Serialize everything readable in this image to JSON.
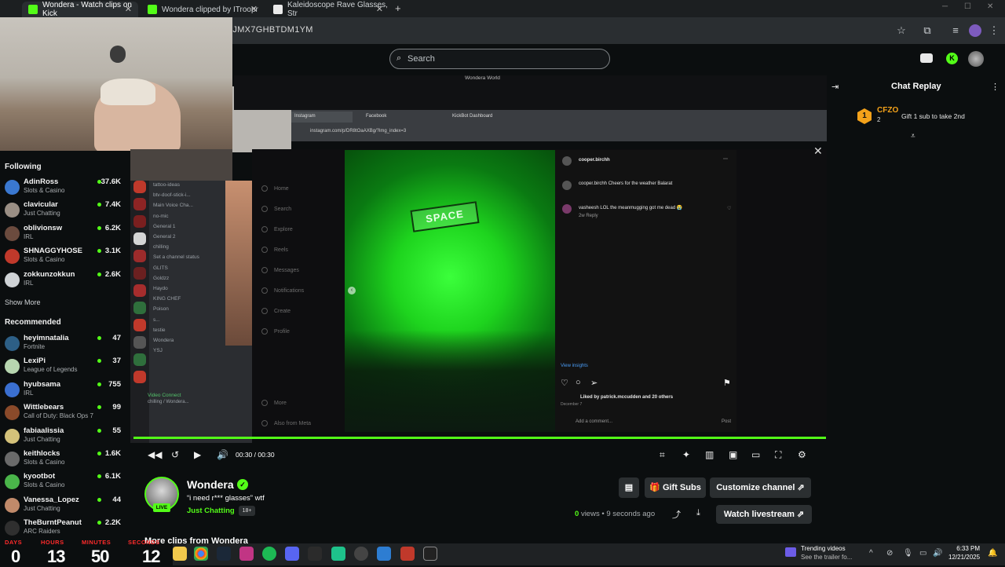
{
  "browser": {
    "tabs": [
      {
        "label": "Wondera - Watch clips on Kick",
        "active": true
      },
      {
        "label": "Wondera clipped by ITroopr",
        "active": false
      },
      {
        "label": "Kaleidoscope Rave Glasses, Str",
        "active": false
      }
    ],
    "url_fragment": "0JMX7GHBTDM1YM"
  },
  "kick": {
    "search_placeholder": "Search",
    "chat_title": "Chat Replay",
    "pinned": {
      "name": "CFZO",
      "count": "2",
      "message": "Gift 1 sub to take 2nd",
      "badge": "1"
    }
  },
  "sidebar": {
    "following_title": "Following",
    "following": [
      {
        "name": "AdinRoss",
        "category": "Slots & Casino",
        "viewers": "37.6K",
        "color": "#3a78d0"
      },
      {
        "name": "clavicular",
        "category": "Just Chatting",
        "viewers": "7.4K",
        "color": "#9a8f85"
      },
      {
        "name": "oblivionsw",
        "category": "IRL",
        "viewers": "6.2K",
        "color": "#6b4b3e"
      },
      {
        "name": "SHNAGGYHOSE",
        "category": "Slots & Casino",
        "viewers": "3.1K",
        "color": "#c0392b"
      },
      {
        "name": "zokkunzokkun",
        "category": "IRL",
        "viewers": "2.6K",
        "color": "#cfd3d6"
      }
    ],
    "show_more": "Show More",
    "recommended_title": "Recommended",
    "recommended": [
      {
        "name": "heyimnatalia",
        "category": "Fortnite",
        "viewers": "47",
        "color": "#2d5f86"
      },
      {
        "name": "LexiPi",
        "category": "League of Legends",
        "viewers": "37",
        "color": "#b7d6b0"
      },
      {
        "name": "hyubsama",
        "category": "IRL",
        "viewers": "755",
        "color": "#3a6fd0"
      },
      {
        "name": "Wittlebears",
        "category": "Call of Duty: Black Ops 7",
        "viewers": "99",
        "color": "#8a4a2a"
      },
      {
        "name": "fabiaalissia",
        "category": "Just Chatting",
        "viewers": "55",
        "color": "#d4c27a"
      },
      {
        "name": "keithlocks",
        "category": "Slots & Casino",
        "viewers": "1.6K",
        "color": "#6a6a6a"
      },
      {
        "name": "kyootbot",
        "category": "Slots & Casino",
        "viewers": "6.1K",
        "color": "#4ab54a"
      },
      {
        "name": "Vanessa_Lopez",
        "category": "Just Chatting",
        "viewers": "44",
        "color": "#c08a6a"
      },
      {
        "name": "TheBurntPeanut",
        "category": "ARC Raiders",
        "viewers": "2.2K",
        "color": "#2f2f2f"
      }
    ]
  },
  "video": {
    "time": "00:30 / 00:30",
    "instagram": {
      "tabs": [
        "Instagram",
        "Facebook",
        "KickBot Dashboard"
      ],
      "url": "instagram.com/p/DR8tOaAXBg/?img_index=3",
      "user": "cooper.birchh",
      "caption": "cooper.birchh Cheers for the weather Balarat",
      "comment_user": "vasheesh",
      "comment": "vasheesh LOL the meanmugging got me dead 😭",
      "reply": "2w  Reply",
      "view_insights": "View insights",
      "liked_by": "Liked by patrick.mccudden and 20 others",
      "date": "December 7",
      "add_comment": "Add a comment...",
      "post": "Post",
      "menu": [
        "Home",
        "Search",
        "Explore",
        "Reels",
        "Messages",
        "Notifications",
        "Create",
        "Profile",
        "More",
        "Also from Meta"
      ],
      "window_title": "Wondera World",
      "sign_text": "SPACE"
    },
    "discord": {
      "channels": [
        "tattoo-ideas",
        "btv-doof-stick-i...",
        "Main Voice Cha...",
        "no-mic",
        "General 1",
        "General 2",
        "chilling",
        "Set a channel status",
        "GLITS",
        "Goldzz",
        "Haydo",
        "KING CHEF",
        "Poison",
        "s...",
        "testie",
        "Wondera",
        "YSJ"
      ],
      "voice_connect": "Video Connect",
      "voice_sub": "chilling / Wondera..."
    }
  },
  "channel": {
    "name": "Wondera",
    "live": "LIVE",
    "clip_title": "“i need r*** glasses” wtf",
    "category": "Just Chatting",
    "age_badge": "18+",
    "views_count": "0",
    "views_label": "views",
    "posted": "9 seconds ago",
    "gift_subs": "Gift Subs",
    "customize": "Customize channel",
    "watch_live": "Watch livestream",
    "more_clips": "More clips from Wondera"
  },
  "countdown": {
    "labels": [
      "DAYS",
      "HOURS",
      "MINUTES",
      "SECONDS"
    ],
    "values": [
      "0",
      "13",
      "50",
      "12"
    ]
  },
  "taskbar": {
    "trending_title": "Trending videos",
    "trending_sub": "See the trailer fo...",
    "time": "6:33 PM",
    "date": "12/21/2025"
  },
  "colors": {
    "kick_green": "#53fc18",
    "bg": "#0b0e0f",
    "button": "#2b2f31",
    "countdown_red": "#ff2b2b"
  }
}
